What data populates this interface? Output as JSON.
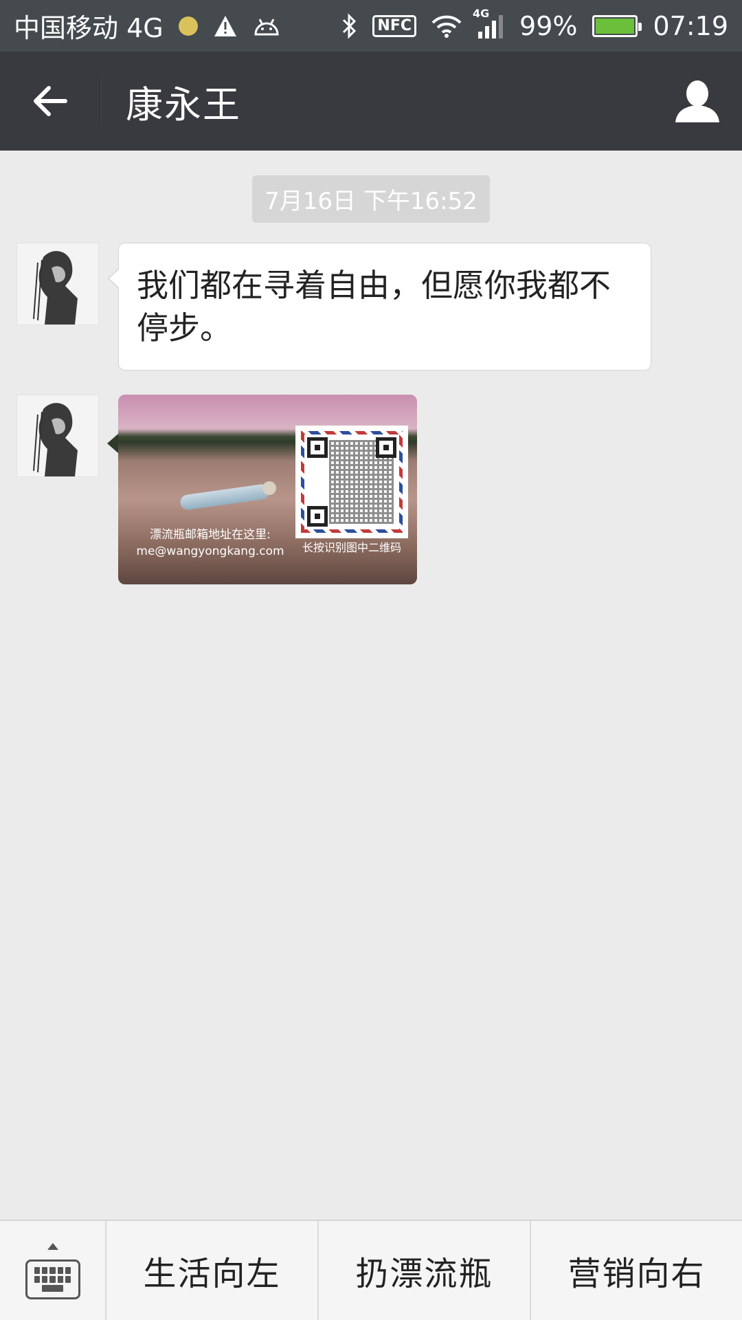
{
  "status_bar": {
    "carrier": "中国移动 4G",
    "network_badge": "4G",
    "battery_percent": "99%",
    "time": "07:19",
    "nfc_label": "NFC",
    "icons": [
      "notification-dot-icon",
      "warning-icon",
      "android-icon",
      "bluetooth-icon",
      "nfc-icon",
      "wifi-icon",
      "signal-icon",
      "battery-icon"
    ]
  },
  "header": {
    "title": "康永王",
    "back_icon": "back-arrow-icon",
    "profile_icon": "person-icon"
  },
  "chat": {
    "timestamp": "7月16日 下午16:52",
    "messages": [
      {
        "type": "text",
        "text": "我们都在寻着自由，但愿你我都不停步。"
      },
      {
        "type": "image",
        "caption_left_line1": "漂流瓶邮箱地址在这里:",
        "caption_left_line2": "me@wangyongkang.com",
        "caption_right": "长按识别图中二维码"
      }
    ]
  },
  "bottom_menu": {
    "keyboard_icon": "keyboard-icon",
    "items": [
      "生活向左",
      "扔漂流瓶",
      "营销向右"
    ]
  },
  "colors": {
    "status_bar_bg": "#444a4e",
    "header_bg": "#393a3f",
    "chat_bg": "#ebebeb",
    "bubble_bg": "#ffffff",
    "battery_fill": "#6bbf3a",
    "notification_dot": "#d9c25b"
  }
}
